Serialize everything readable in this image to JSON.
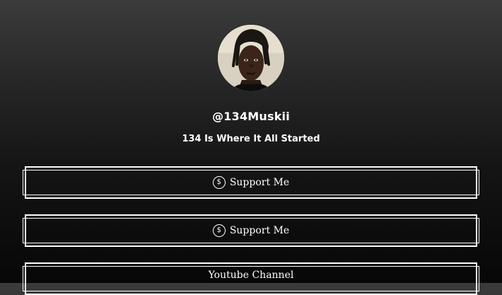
{
  "profile": {
    "handle": "@134Muskii",
    "bio": "134 Is Where It All Started"
  },
  "links": [
    {
      "label": "Support Me",
      "icon": "dollar-coin-icon"
    },
    {
      "label": "Support Me",
      "icon": "dollar-coin-icon"
    },
    {
      "label": "Youtube Channel",
      "icon": ""
    }
  ],
  "icons": {
    "dollar_symbol": "$"
  },
  "colors": {
    "background_top": "#3b3b3b",
    "background_bottom": "#070707",
    "text": "#ffffff",
    "button_border": "#ffffff"
  }
}
